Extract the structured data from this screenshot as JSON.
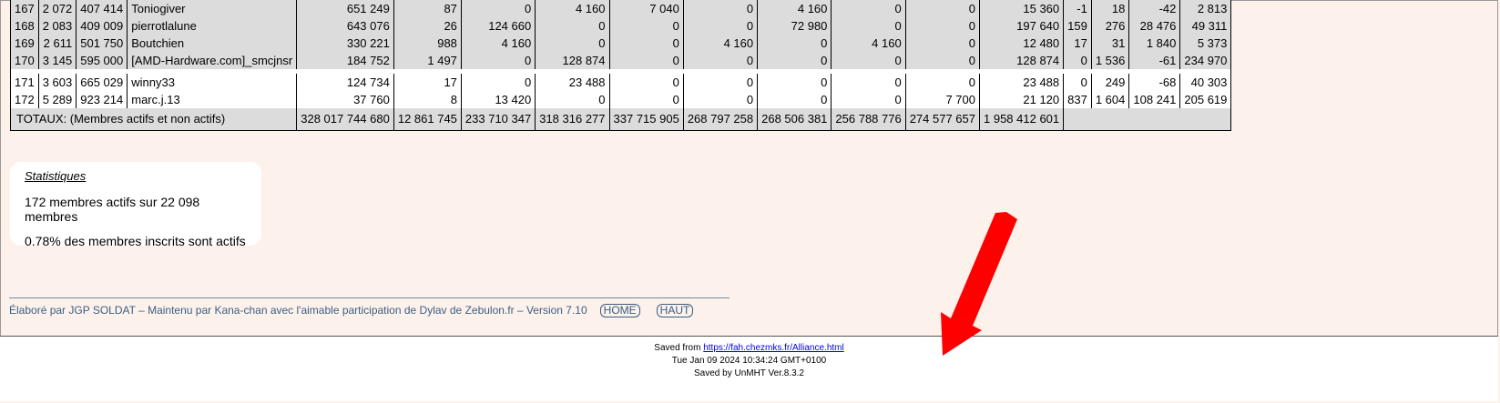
{
  "table": {
    "rows": [
      {
        "style": "grey",
        "cells": [
          "167",
          "2 072",
          "407 414",
          "Toniogiver",
          "651 249",
          "87",
          "0",
          "4 160",
          "7 040",
          "0",
          "4 160",
          "0",
          "0",
          "15 360",
          "-1",
          "18",
          "-42",
          "2 813"
        ]
      },
      {
        "style": "grey",
        "cells": [
          "168",
          "2 083",
          "409 009",
          "pierrotlalune",
          "643 076",
          "26",
          "124 660",
          "0",
          "0",
          "0",
          "72 980",
          "0",
          "0",
          "197 640",
          "159",
          "276",
          "28 476",
          "49 311"
        ]
      },
      {
        "style": "grey",
        "cells": [
          "169",
          "2 611",
          "501 750",
          "Boutchien",
          "330 221",
          "988",
          "4 160",
          "0",
          "0",
          "4 160",
          "0",
          "4 160",
          "0",
          "12 480",
          "17",
          "31",
          "1 840",
          "5 373"
        ]
      },
      {
        "style": "grey",
        "cells": [
          "170",
          "3 145",
          "595 000",
          "[AMD-Hardware.com]_smcjnsr",
          "184 752",
          "1 497",
          "0",
          "128 874",
          "0",
          "0",
          "0",
          "0",
          "0",
          "128 874",
          "0",
          "1 536",
          "-61",
          "234 970"
        ]
      },
      {
        "style": "spacer",
        "cells": []
      },
      {
        "style": "white",
        "cells": [
          "171",
          "3 603",
          "665 029",
          "winny33",
          "124 734",
          "17",
          "0",
          "23 488",
          "0",
          "0",
          "0",
          "0",
          "0",
          "23 488",
          "0",
          "249",
          "-68",
          "40 303"
        ]
      },
      {
        "style": "white",
        "cells": [
          "172",
          "5 289",
          "923 214",
          "marc.j.13",
          "37 760",
          "8",
          "13 420",
          "0",
          "0",
          "0",
          "0",
          "0",
          "7 700",
          "21 120",
          "837",
          "1 604",
          "108 241",
          "205 619"
        ]
      }
    ],
    "totals": {
      "label": "TOTAUX: (Membres actifs et non actifs)",
      "values": [
        "328 017 744 680",
        "12 861 745",
        "233 710 347",
        "318 316 277",
        "337 715 905",
        "268 797 258",
        "268 506 381",
        "256 788 776",
        "274 577 657",
        "1 958 412 601"
      ]
    }
  },
  "statistics": {
    "title": "Statistiques",
    "active_line": "172 membres actifs sur 22 098 membres",
    "percent_line": "0.78% des membres inscrits sont actifs"
  },
  "footer": {
    "credit": "Élaboré par JGP SOLDAT – Maintenu par Kana-chan avec l'aimable participation de Dylav de Zebulon.fr – Version 7.10",
    "home_label": "HOME",
    "top_label": "HAUT"
  },
  "saved": {
    "prefix": "Saved from",
    "url": "https://fah.chezmks.fr/Alliance.html",
    "date": "Tue Jan 09 2024 10:34:24 GMT+0100",
    "by": "Saved by UnMHT Ver.8.3.2"
  },
  "colors": {
    "arrow": "#ff0000",
    "row_grey": "#dcdcdc",
    "page_bg": "#fdf1ec",
    "footer_link": "#3a5f80"
  },
  "icons": {
    "annotation": "red-arrow-icon"
  }
}
